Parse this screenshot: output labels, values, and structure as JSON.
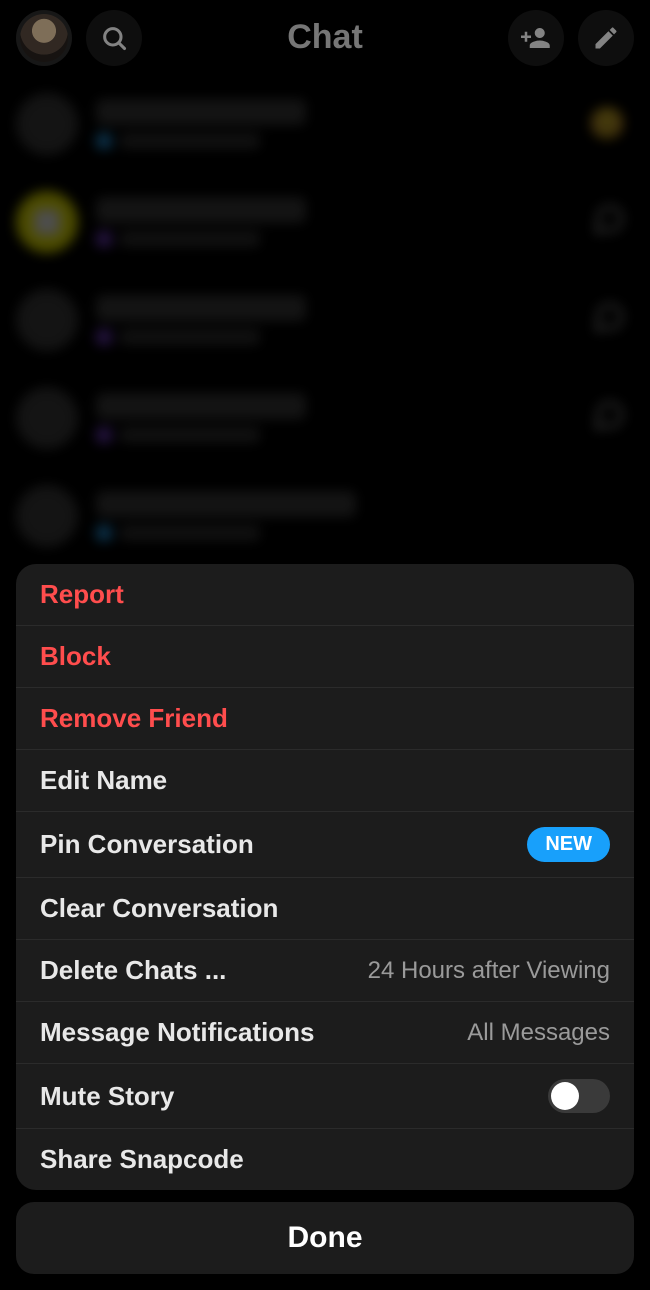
{
  "header": {
    "title": "Chat"
  },
  "chats": [
    {
      "name": "—",
      "status_color": "blue",
      "trailing": "emoji",
      "emoji": "😊"
    },
    {
      "name": "—",
      "status_color": "purple",
      "avatar": "yellow",
      "trailing": "chat"
    },
    {
      "name": "—",
      "status_color": "purple",
      "trailing": "chat"
    },
    {
      "name": "—",
      "status_color": "purple",
      "trailing": "chat"
    },
    {
      "name": "—",
      "status_color": "blue",
      "trailing": "none"
    }
  ],
  "sheet": {
    "report": "Report",
    "block": "Block",
    "remove_friend": "Remove Friend",
    "edit_name": "Edit Name",
    "pin": "Pin Conversation",
    "pin_badge": "NEW",
    "clear": "Clear Conversation",
    "delete_chats": "Delete Chats ...",
    "delete_chats_value": "24 Hours after Viewing",
    "msg_notifs": "Message Notifications",
    "msg_notifs_value": "All Messages",
    "mute_story": "Mute Story",
    "mute_story_on": false,
    "share_snapcode": "Share Snapcode"
  },
  "done": "Done"
}
